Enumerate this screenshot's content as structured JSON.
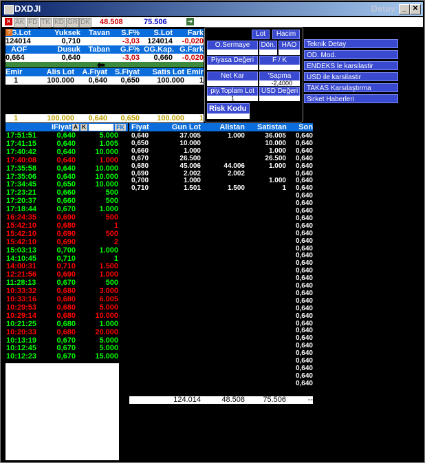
{
  "window": {
    "title": "DXDJI",
    "title_right": "Detay"
  },
  "toolbar": {
    "buttons": [
      "AK",
      "FD",
      "TK",
      "KD",
      "GR",
      "DK"
    ],
    "value1": "48.508",
    "value2": "75.506"
  },
  "summary": {
    "headers1": [
      "G.Lot",
      "Yuksek",
      "Tavan",
      "S.F%",
      "S.Lot",
      "Fark"
    ],
    "values1": [
      "124014",
      "0,710",
      "",
      "-3,03",
      "124014",
      "-0,020"
    ],
    "headers2": [
      "AOF",
      "Dusuk",
      "Taban",
      "G.F%",
      "OG.Kap.",
      "G.Fark"
    ],
    "values2": [
      "0,664",
      "0,640",
      "",
      "-3,03",
      "0,660",
      "-0,020"
    ],
    "arrow": "⬅"
  },
  "order_header": [
    "Emir",
    "Alis Lot",
    "A.Fiyat",
    "S.Fiyat",
    "Satis Lot",
    "Emir"
  ],
  "order_row": [
    "1",
    "100.000",
    "0,640",
    "0,650",
    "100.000",
    "1"
  ],
  "order_total": [
    "1",
    "100.000",
    "0,640",
    "0,650",
    "100.000",
    "1"
  ],
  "panel": {
    "lot": "Lot",
    "hacim": "Hacim",
    "o_sermaye": "O.Sermaye",
    "don": "Dön.",
    "hao": "HAO",
    "piyasa_degeri": "Piyasa Değeri",
    "f_k": "F / K",
    "net_kar": "Net Kar",
    "sapma": "'Sapma",
    "sapma_value": "-2,4000",
    "piy_toplam_lot": "piy.Toplam Lot",
    "piy_toplam_value": "1",
    "usd_degeri": "USD Değeri",
    "risk_kodu": "Risk Kodu"
  },
  "menu": [
    "Teknik Detay",
    "OD. Mod.",
    "ENDEKS le karsilastir",
    "USD ile karsilastir",
    "TAKAS Karsılaştırma",
    "Sirket Haberleri"
  ],
  "trades_header": {
    "price": "IFiyat",
    "a": "A",
    "k": "K",
    "fk": "FK"
  },
  "trades": [
    {
      "time": "17:51:51",
      "price": "0,640",
      "lot": "5.000",
      "color": "#00ff00"
    },
    {
      "time": "17:41:15",
      "price": "0,640",
      "lot": "1.005",
      "color": "#00ff00"
    },
    {
      "time": "17:40:42",
      "price": "0,640",
      "lot": "10.000",
      "color": "#00ff00"
    },
    {
      "time": "17:40:08",
      "price": "0,640",
      "lot": "1.000",
      "color": "#ff0000"
    },
    {
      "time": "17:35:58",
      "price": "0,640",
      "lot": "10.000",
      "color": "#00ff00"
    },
    {
      "time": "17:35:06",
      "price": "0,640",
      "lot": "10.000",
      "color": "#00ff00"
    },
    {
      "time": "17:34:45",
      "price": "0,650",
      "lot": "10.000",
      "color": "#00ff00"
    },
    {
      "time": "17:23:21",
      "price": "0,660",
      "lot": "500",
      "color": "#00ff00"
    },
    {
      "time": "17:20:37",
      "price": "0,660",
      "lot": "500",
      "color": "#00ff00"
    },
    {
      "time": "17:18:44",
      "price": "0,670",
      "lot": "1.000",
      "color": "#00ff00"
    },
    {
      "time": "16:24:35",
      "price": "0,690",
      "lot": "500",
      "color": "#ff0000"
    },
    {
      "time": "15:42:10",
      "price": "0,680",
      "lot": "1",
      "color": "#ff0000"
    },
    {
      "time": "15:42:10",
      "price": "0,690",
      "lot": "500",
      "color": "#ff0000"
    },
    {
      "time": "15:42:10",
      "price": "0,690",
      "lot": "2",
      "color": "#ff0000"
    },
    {
      "time": "15:03:13",
      "price": "0,700",
      "lot": "1.000",
      "color": "#00ff00"
    },
    {
      "time": "14:10:45",
      "price": "0,710",
      "lot": "1",
      "color": "#00ff00"
    },
    {
      "time": "14:00:31",
      "price": "0,710",
      "lot": "1.500",
      "color": "#ff0000"
    },
    {
      "time": "12:21:56",
      "price": "0,690",
      "lot": "1.000",
      "color": "#ff0000"
    },
    {
      "time": "11:28:13",
      "price": "0,670",
      "lot": "500",
      "color": "#00ff00"
    },
    {
      "time": "10:33:32",
      "price": "0,680",
      "lot": "3.000",
      "color": "#ff0000"
    },
    {
      "time": "10:33:16",
      "price": "0,680",
      "lot": "6.005",
      "color": "#ff0000"
    },
    {
      "time": "10:29:53",
      "price": "0,680",
      "lot": "5.000",
      "color": "#ff0000"
    },
    {
      "time": "10:29:14",
      "price": "0,680",
      "lot": "10.000",
      "color": "#ff0000"
    },
    {
      "time": "10:21:25",
      "price": "0,680",
      "lot": "1.000",
      "color": "#00ff00"
    },
    {
      "time": "10:20:33",
      "price": "0,680",
      "lot": "20.000",
      "color": "#ff0000"
    },
    {
      "time": "10:13:19",
      "price": "0,670",
      "lot": "5.000",
      "color": "#00ff00"
    },
    {
      "time": "10:12:45",
      "price": "0,670",
      "lot": "5.000",
      "color": "#00ff00"
    },
    {
      "time": "10:12:23",
      "price": "0,670",
      "lot": "15.000",
      "color": "#00ff00"
    }
  ],
  "depth_header": [
    "Fiyat",
    "Gun Lot",
    "Alistan",
    "Satistan",
    "Son"
  ],
  "depth": [
    [
      "0,640",
      "37.005",
      "1.000",
      "36.005",
      "0,640"
    ],
    [
      "0,650",
      "10.000",
      "",
      "10.000",
      "0,640"
    ],
    [
      "0,660",
      "1.000",
      "",
      "1.000",
      "0,640"
    ],
    [
      "0,670",
      "26.500",
      "",
      "26.500",
      "0,640"
    ],
    [
      "0,680",
      "45.006",
      "44.006",
      "1.000",
      "0,640"
    ],
    [
      "0,690",
      "2.002",
      "2.002",
      "",
      "0,640"
    ],
    [
      "0,700",
      "1.000",
      "",
      "1.000",
      "0,640"
    ],
    [
      "0,710",
      "1.501",
      "1.500",
      "1",
      "0,640"
    ]
  ],
  "son_extra": [
    "0,640",
    "0,640",
    "0,640",
    "0,640",
    "0,640",
    "0,640",
    "0,640",
    "0,640",
    "0,640",
    "0,640",
    "0,640",
    "0,640",
    "0,640",
    "0,640",
    "0,640",
    "0,640",
    "0,640",
    "0,640",
    "0,640",
    "0,640",
    "0,640",
    "0,640",
    "0,640",
    "0,640",
    "0,640",
    "0,640"
  ],
  "depth_total": [
    "124.014",
    "48.508",
    "75.506",
    "--"
  ]
}
